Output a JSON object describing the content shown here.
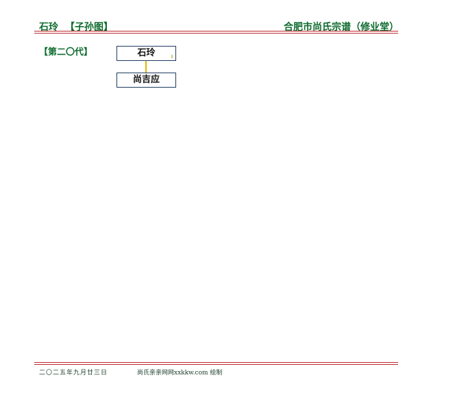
{
  "header": {
    "person": "石玲",
    "section": "【子孙图】",
    "genealogy": "合肥市尚氏宗谱（修业堂）"
  },
  "generation": {
    "label": "【第二〇代】"
  },
  "tree": {
    "root": {
      "name": "石玲",
      "mark": "⇓"
    },
    "child": {
      "name": "尚吉应"
    }
  },
  "footer": {
    "date": "二〇二五年九月廿三日",
    "credit": "尚氏亲亲网网xxkkw.com 绘制"
  },
  "colors": {
    "title_green": "#0e6b2e",
    "rule_red": "#c0282d",
    "connector_yellow": "#e2b400",
    "node_border": "#1f3a5f"
  }
}
